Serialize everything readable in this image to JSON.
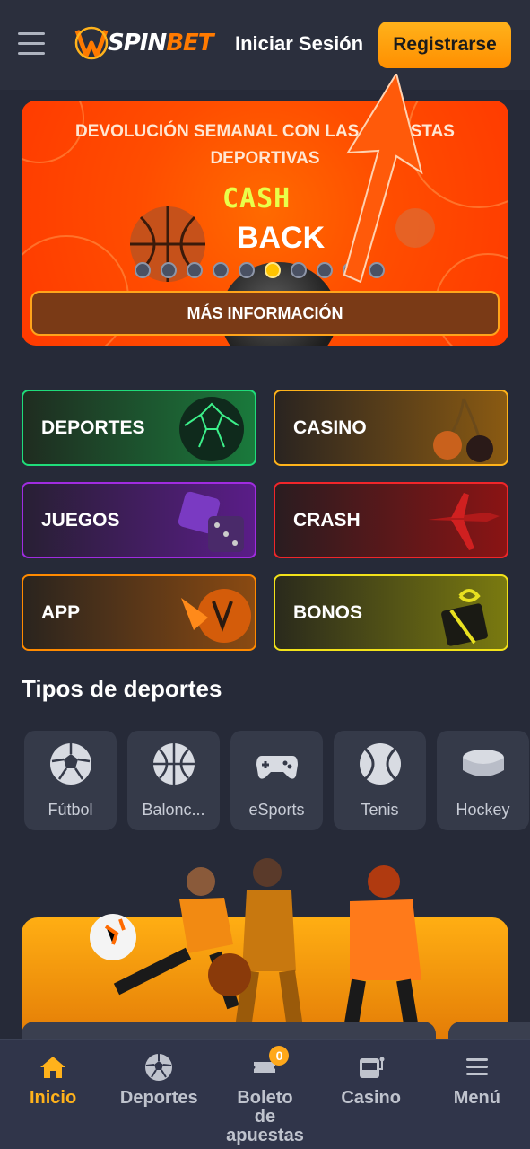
{
  "header": {
    "login_label": "Iniciar Sesión",
    "register_label": "Registrarse"
  },
  "banner": {
    "title": "DEVOLUCIÓN SEMANAL CON LAS APUESTAS DEPORTIVAS",
    "art_text_1": "CASH",
    "art_text_2": "BACK",
    "more_label": "MÁS INFORMACIÓN",
    "slide_count": 10,
    "active_slide": 6
  },
  "categories": [
    {
      "label": "DEPORTES",
      "color": "#1fdc7a"
    },
    {
      "label": "CASINO",
      "color": "#ffb31a"
    },
    {
      "label": "JUEGOS",
      "color": "#a02ce0"
    },
    {
      "label": "CRASH",
      "color": "#f0262a"
    },
    {
      "label": "APP",
      "color": "#ff8a00"
    },
    {
      "label": "BONOS",
      "color": "#f2e21a"
    }
  ],
  "sports_section": {
    "title": "Tipos de deportes",
    "items": [
      {
        "label": "Fútbol",
        "icon": "soccer-ball-icon"
      },
      {
        "label": "Balonc...",
        "icon": "basketball-icon"
      },
      {
        "label": "eSports",
        "icon": "gamepad-icon"
      },
      {
        "label": "Tenis",
        "icon": "tennis-ball-icon"
      },
      {
        "label": "Hockey",
        "icon": "hockey-puck-icon"
      }
    ]
  },
  "bottom_nav": {
    "items": [
      {
        "label": "Inicio",
        "icon": "home-icon",
        "active": true
      },
      {
        "label": "Deportes",
        "icon": "soccer-ball-icon"
      },
      {
        "label_lines": [
          "Boleto",
          "de",
          "apuestas"
        ],
        "icon": "ticket-icon",
        "badge": "0"
      },
      {
        "label": "Casino",
        "icon": "slot-machine-icon"
      },
      {
        "label": "Menú",
        "icon": "menu-icon"
      }
    ]
  },
  "colors": {
    "accent": "#ffa81a",
    "background": "#262a38"
  }
}
